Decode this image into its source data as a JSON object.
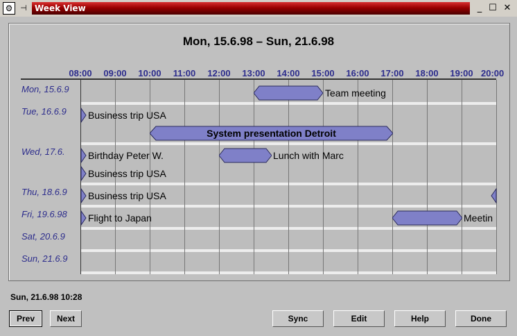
{
  "window": {
    "title": "Week View"
  },
  "heading": "Mon, 15.6.98 – Sun, 21.6.98",
  "hours": [
    "08:00",
    "09:00",
    "10:00",
    "11:00",
    "12:00",
    "13:00",
    "14:00",
    "15:00",
    "16:00",
    "17:00",
    "18:00",
    "19:00",
    "20:00"
  ],
  "days": [
    "Mon, 15.6.9",
    "Tue, 16.6.9",
    "Wed, 17.6.",
    "Thu, 18.6.9",
    "Fri, 19.6.98",
    "Sat, 20.6.9",
    "Sun, 21.6.9"
  ],
  "events": {
    "team_meeting": "Team meeting",
    "business_trip_tue": "Business trip USA",
    "system_presentation": "System presentation Detroit",
    "birthday": "Birthday Peter W.",
    "lunch": "Lunch with Marc",
    "business_trip_wed": "Business trip USA",
    "business_trip_thu": "Business trip USA",
    "flight": "Flight to Japan",
    "meeting_fri": "Meetin"
  },
  "status": "Sun, 21.6.98 10:28",
  "buttons": {
    "prev": "Prev",
    "next": "Next",
    "sync": "Sync",
    "edit": "Edit",
    "help": "Help",
    "done": "Done"
  },
  "colors": {
    "event_fill": "#7f80c8",
    "hour_label": "#2c2c8c",
    "title_bar": "#9a0000"
  }
}
